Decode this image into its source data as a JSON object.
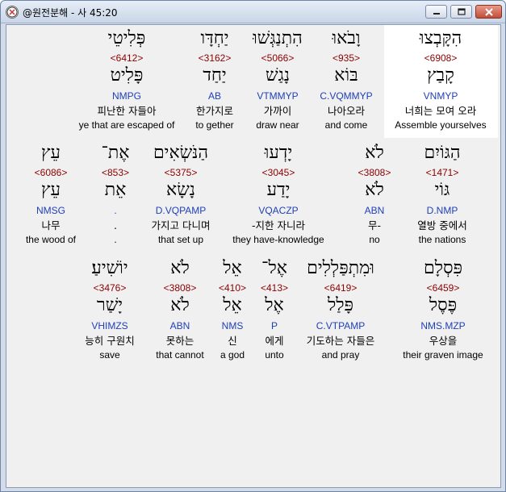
{
  "window": {
    "title": "@원전분해 - 사 45:20"
  },
  "rows": [
    {
      "words": [
        {
          "hebrew": "הִקָּבְצוּ",
          "strong": "<6908>",
          "lemma": "קָבַץ",
          "morph": "VNMYP",
          "korean": "너희는 모여 오라",
          "english": "Assemble yourselves"
        },
        {
          "hebrew": "וָבֹאוּ",
          "strong": "<935>",
          "lemma": "בּוֹא",
          "morph": "C.VQMMYP",
          "korean": "나아오라",
          "english": "and come"
        },
        {
          "hebrew": "הִתְנַגְּשׁוּ",
          "strong": "<5066>",
          "lemma": "נָגַשׁ",
          "morph": "VTMMYP",
          "korean": "가까이",
          "english": "draw near"
        },
        {
          "hebrew": "יַחְדָּו",
          "strong": "<3162>",
          "lemma": "יַחַד",
          "morph": "AB",
          "korean": "한가지로",
          "english": "to gether"
        },
        {
          "hebrew": "פְּלִיטֵי",
          "strong": "<6412>",
          "lemma": "פָּלִיט",
          "morph": "NMPG",
          "korean": "피난한 자들아",
          "english": "ye that are escaped of"
        }
      ]
    },
    {
      "words": [
        {
          "hebrew": "הַגּוֹיִם",
          "strong": "<1471>",
          "lemma": "גּוֹי",
          "morph": "D.NMP",
          "korean": "열방 중에서",
          "english": "the nations"
        },
        {
          "hebrew": "לֹא",
          "strong": "<3808>",
          "lemma": "לֹא",
          "morph": "ABN",
          "korean": "무-",
          "english": "no"
        },
        {
          "hebrew": "יָדְעוּ",
          "strong": "<3045>",
          "lemma": "יָדַע",
          "morph": "VQACZP",
          "korean": "-지한 자니라",
          "english": "they have-knowledge"
        },
        {
          "hebrew": "הַנֹּשְׂאִים",
          "strong": "<5375>",
          "lemma": "נָשָׂא",
          "morph": "D.VQPAMP",
          "korean": "가지고 다니며",
          "english": "that set up"
        },
        {
          "hebrew": "אֶת־",
          "strong": "<853>",
          "lemma": "אֵת",
          "morph": ".",
          "korean": ".",
          "english": "."
        },
        {
          "hebrew": "עֵץ",
          "strong": "<6086>",
          "lemma": "עֵץ",
          "morph": "NMSG",
          "korean": "나무",
          "english": "the wood of"
        }
      ]
    },
    {
      "words": [
        {
          "hebrew": "פִּסְלָם",
          "strong": "<6459>",
          "lemma": "פֶּסֶל",
          "morph": "NMS.MZP",
          "korean": "우상을",
          "english": "their graven image"
        },
        {
          "hebrew": "וּמִתְפַּלְלִים",
          "strong": "<6419>",
          "lemma": "פָּלַל",
          "morph": "C.VTPAMP",
          "korean": "기도하는 자들은",
          "english": "and pray"
        },
        {
          "hebrew": "אֶל־",
          "strong": "<413>",
          "lemma": "אֶל",
          "morph": "P",
          "korean": "에게",
          "english": "unto"
        },
        {
          "hebrew": "אֵל",
          "strong": "<410>",
          "lemma": "אֵל",
          "morph": "NMS",
          "korean": "신",
          "english": "a god"
        },
        {
          "hebrew": "לֹא",
          "strong": "<3808>",
          "lemma": "לֹא",
          "morph": "ABN",
          "korean": "못하는",
          "english": "that cannot"
        },
        {
          "hebrew": "יוֹשִׁיעַ׃",
          "strong": "<3476>",
          "lemma": "יָשַׁר",
          "morph": "VHIMZS",
          "korean": "능히 구원치",
          "english": "save"
        }
      ]
    }
  ]
}
